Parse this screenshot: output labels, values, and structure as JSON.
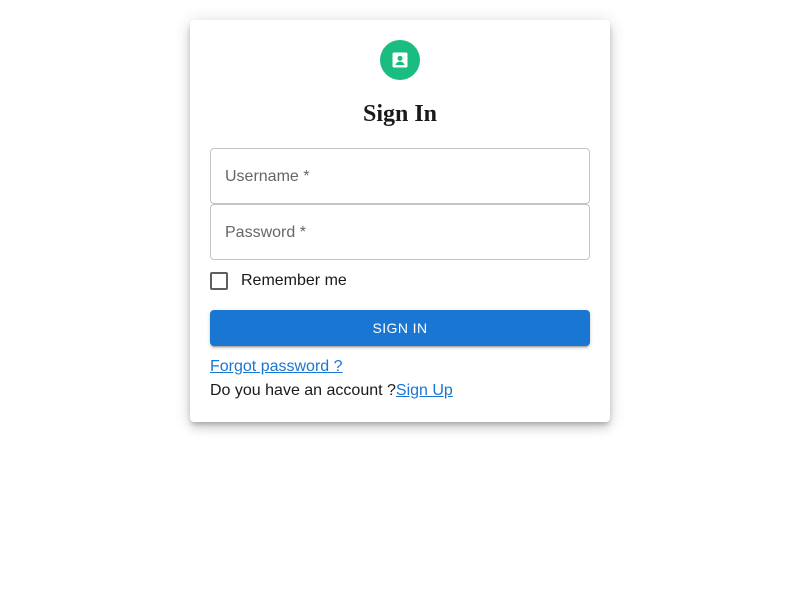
{
  "colors": {
    "avatar_bg": "#1abc7f",
    "primary": "#1976d2",
    "link": "#1976d2",
    "card_bg": "#ffffff"
  },
  "header": {
    "icon": "account-box-icon",
    "title": "Sign In"
  },
  "form": {
    "username": {
      "label": "Username *",
      "value": ""
    },
    "password": {
      "label": "Password *",
      "value": ""
    },
    "remember": {
      "label": "Remember me",
      "checked": false
    },
    "submit_label": "Sign In"
  },
  "links": {
    "forgot_password": "Forgot password ?",
    "account_prompt": "Do you have an account ?",
    "sign_up": "Sign Up"
  }
}
